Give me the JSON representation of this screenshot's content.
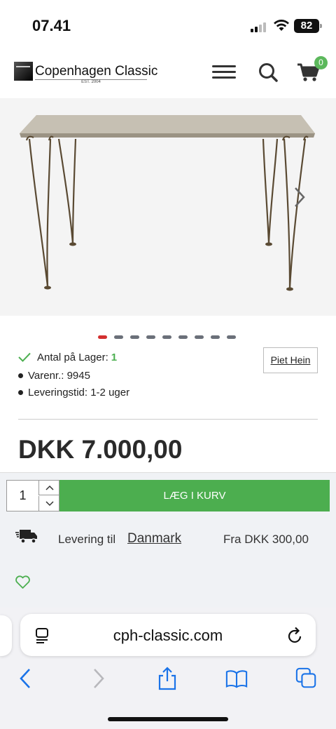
{
  "status": {
    "time": "07.41",
    "battery": "82"
  },
  "header": {
    "logo_name": "Copenhagen Classic",
    "logo_est": "EST. 2004",
    "cart_count": "0"
  },
  "gallery": {
    "slide_count": 9,
    "active_index": 0
  },
  "stock": {
    "label": "Antal på Lager:",
    "value": "1"
  },
  "details": {
    "sku": "Varenr.: 9945",
    "delivery_time": "Leveringstid: 1-2 uger"
  },
  "brand_link": "Piet Hein",
  "price": "DKK 7.000,00",
  "cart": {
    "quantity": "1",
    "add_label": "LÆG I KURV"
  },
  "delivery": {
    "label": "Levering til",
    "country": "Danmark",
    "price": "Fra DKK 300,00"
  },
  "browser": {
    "url": "cph-classic.com"
  },
  "colors": {
    "accent_green": "#4cae4f",
    "active_dot": "#d32f2f",
    "ios_blue": "#1a73e8"
  }
}
